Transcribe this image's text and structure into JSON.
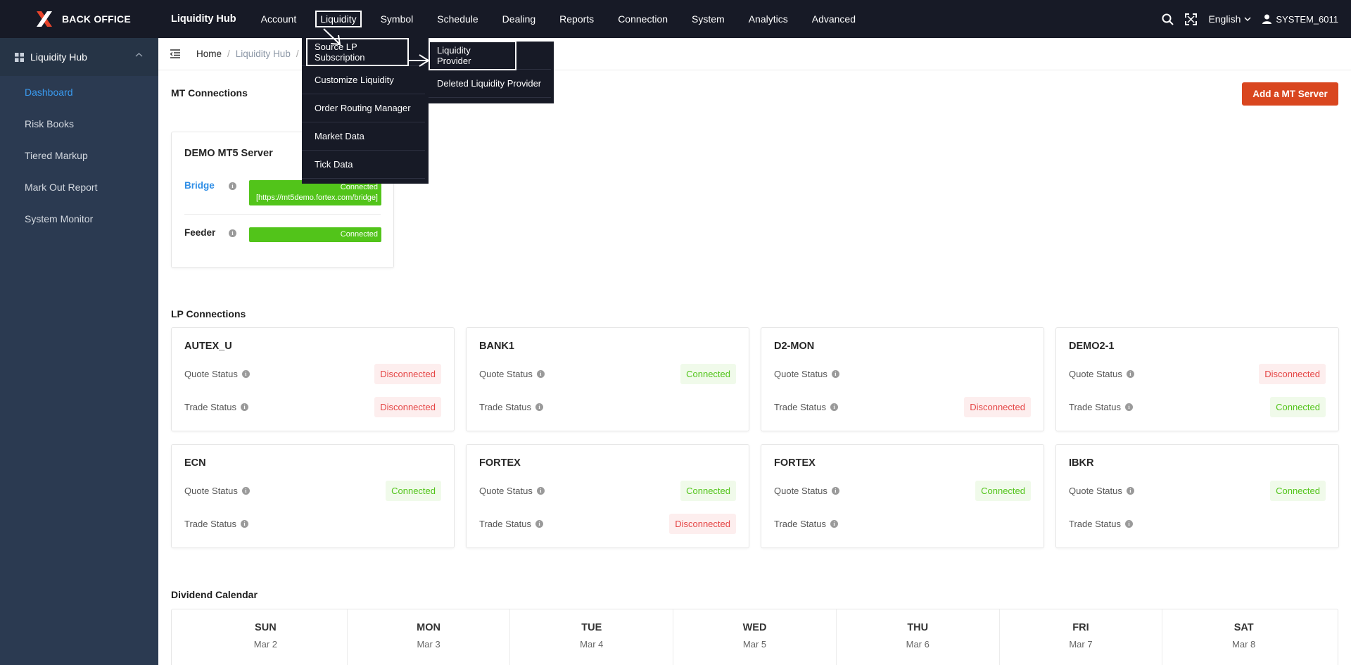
{
  "app": {
    "brand": "BACK OFFICE",
    "hub_title": "Liquidity Hub"
  },
  "topnav": [
    {
      "label": "Account"
    },
    {
      "label": "Liquidity",
      "active": true
    },
    {
      "label": "Symbol"
    },
    {
      "label": "Schedule"
    },
    {
      "label": "Dealing"
    },
    {
      "label": "Reports"
    },
    {
      "label": "Connection"
    },
    {
      "label": "System"
    },
    {
      "label": "Analytics"
    },
    {
      "label": "Advanced"
    }
  ],
  "top_right": {
    "language": "English",
    "user": "SYSTEM_6011"
  },
  "sidebar": {
    "header": "Liquidity Hub",
    "items": [
      {
        "label": "Dashboard",
        "active": true
      },
      {
        "label": "Risk Books"
      },
      {
        "label": "Tiered Markup"
      },
      {
        "label": "Mark Out Report"
      },
      {
        "label": "System Monitor"
      }
    ]
  },
  "breadcrumb": {
    "home": "Home",
    "sep": "/",
    "level1": "Liquidity Hub"
  },
  "liquidity_menu": [
    {
      "label": "Source LP Subscription",
      "highlight": true
    },
    {
      "label": "Customize Liquidity"
    },
    {
      "label": "Order Routing Manager"
    },
    {
      "label": "Market Data"
    },
    {
      "label": "Tick Data"
    }
  ],
  "submenu": [
    {
      "label": "Liquidity Provider",
      "highlight": true
    },
    {
      "label": "Deleted Liquidity Provider"
    }
  ],
  "mt_connections": {
    "title": "MT Connections",
    "add_button": "Add a MT Server",
    "server": {
      "name": "DEMO MT5 Server",
      "bridge_label": "Bridge",
      "bridge_status": "Connected",
      "bridge_url": "[https://mt5demo.fortex.com/bridge]",
      "feeder_label": "Feeder",
      "feeder_status": "Connected"
    }
  },
  "lp_connections": {
    "title": "LP Connections",
    "quote_label": "Quote Status",
    "trade_label": "Trade Status",
    "cards": [
      {
        "name": "AUTEX_U",
        "quote": "Disconnected",
        "trade": "Disconnected"
      },
      {
        "name": "BANK1",
        "quote": "Connected",
        "trade": ""
      },
      {
        "name": "D2-MON",
        "quote": "",
        "trade": "Disconnected"
      },
      {
        "name": "DEMO2-1",
        "quote": "Disconnected",
        "trade": "Connected"
      },
      {
        "name": "ECN",
        "quote": "Connected",
        "trade": ""
      },
      {
        "name": "FORTEX",
        "quote": "Connected",
        "trade": "Disconnected"
      },
      {
        "name": "FORTEX",
        "quote": "Connected",
        "trade": ""
      },
      {
        "name": "IBKR",
        "quote": "Connected",
        "trade": ""
      }
    ]
  },
  "dividend_calendar": {
    "title": "Dividend Calendar",
    "days": [
      {
        "day": "SUN",
        "date": "Mar 2"
      },
      {
        "day": "MON",
        "date": "Mar 3"
      },
      {
        "day": "TUE",
        "date": "Mar 4"
      },
      {
        "day": "WED",
        "date": "Mar 5"
      },
      {
        "day": "THU",
        "date": "Mar 6"
      },
      {
        "day": "FRI",
        "date": "Mar 7"
      },
      {
        "day": "SAT",
        "date": "Mar 8"
      }
    ]
  },
  "colors": {
    "topbar": "#171a26",
    "sidebar": "#2b3a51",
    "accent": "#3a9bf0",
    "danger_btn": "#d9461f",
    "ok": "#52c41a",
    "bad": "#e54545"
  }
}
